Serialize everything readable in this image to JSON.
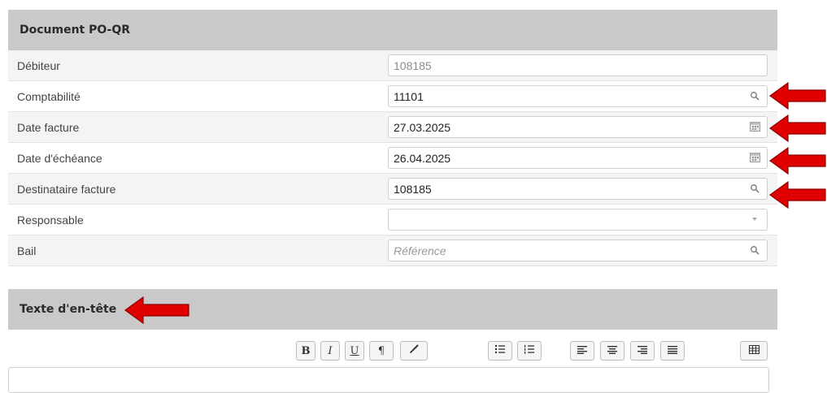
{
  "section1": {
    "title": "Document PO-QR",
    "rows": [
      {
        "label": "Débiteur",
        "value": "108185",
        "readonly": true,
        "icon": "none"
      },
      {
        "label": "Comptabilité",
        "value": "11101",
        "icon": "search-icon"
      },
      {
        "label": "Date facture",
        "value": "27.03.2025",
        "icon": "calendar-icon"
      },
      {
        "label": "Date d'échéance",
        "value": "26.04.2025",
        "icon": "calendar-icon"
      },
      {
        "label": "Destinataire facture",
        "value": "108185",
        "icon": "search-icon"
      },
      {
        "label": "Responsable",
        "value": "",
        "icon": "chevron-down-icon"
      },
      {
        "label": "Bail",
        "value": "",
        "placeholder": "Référence",
        "icon": "search-icon"
      }
    ]
  },
  "section2": {
    "title": "Texte d'en-tête"
  },
  "toolbar": {
    "bold": "B",
    "italic": "I",
    "underline": "U",
    "paragraph": "¶"
  },
  "colors": {
    "header_bg": "#c9c9c9",
    "arrow_red": "#e00000"
  }
}
